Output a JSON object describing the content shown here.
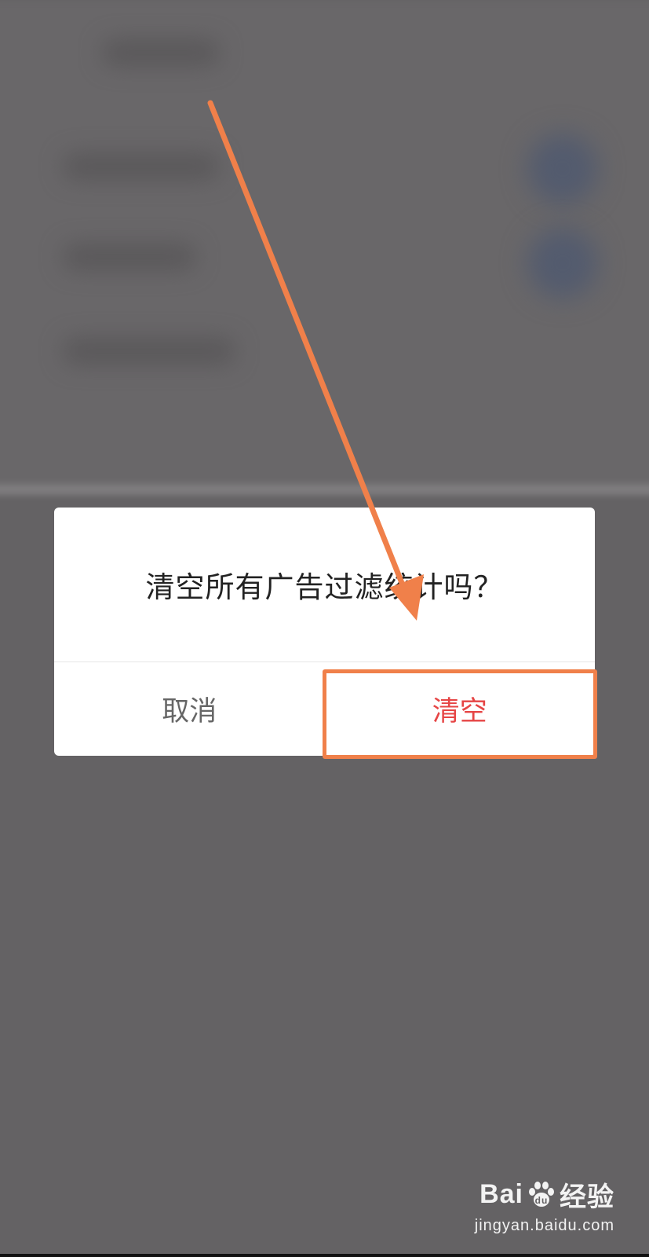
{
  "dialog": {
    "message": "清空所有广告过滤统计吗？",
    "cancel_label": "取消",
    "confirm_label": "清空"
  },
  "colors": {
    "scrim": "#646264",
    "dialog_bg": "#ffffff",
    "confirm_text": "#e64545",
    "cancel_text": "#666666",
    "annotation": "#f0804a"
  },
  "watermark": {
    "logo_text_left": "Bai",
    "logo_text_right": "经验",
    "url": "jingyan.baidu.com"
  }
}
